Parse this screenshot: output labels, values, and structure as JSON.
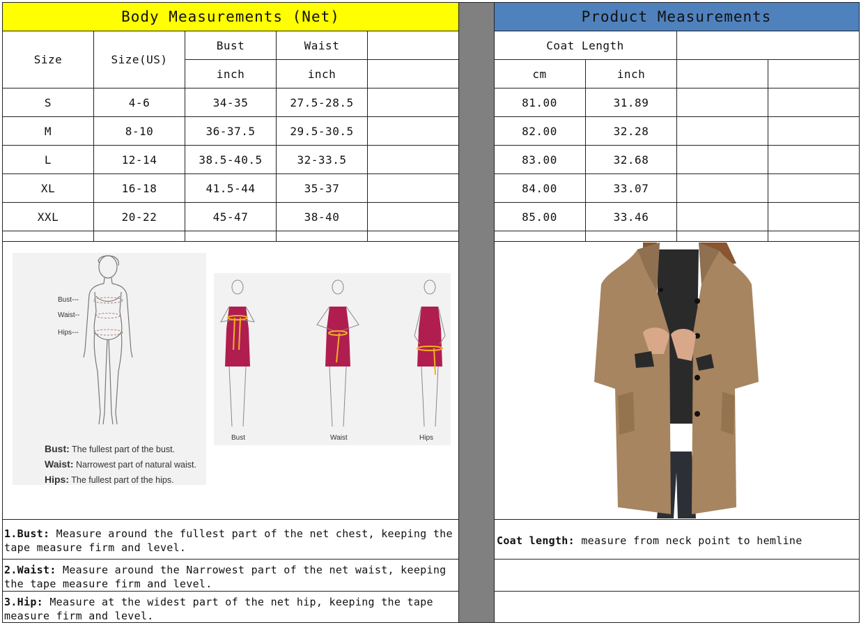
{
  "left_title": "Body Measurements (Net)",
  "right_title": "Product Measurements",
  "colors": {
    "left_header_bg": "#ffff00",
    "right_header_bg": "#4f81bd",
    "divider": "#808080"
  },
  "body_headers": {
    "size": "Size",
    "size_us": "Size(US)",
    "bust": "Bust",
    "waist": "Waist",
    "bust_unit": "inch",
    "waist_unit": "inch"
  },
  "product_headers": {
    "coat_length": "Coat Length",
    "cm": "cm",
    "inch": "inch"
  },
  "rows": [
    {
      "size": "S",
      "us": "4-6",
      "bust": "34-35",
      "waist": "27.5-28.5",
      "cm": "81.00",
      "inch": "31.89"
    },
    {
      "size": "M",
      "us": "8-10",
      "bust": "36-37.5",
      "waist": "29.5-30.5",
      "cm": "82.00",
      "inch": "32.28"
    },
    {
      "size": "L",
      "us": "12-14",
      "bust": "38.5-40.5",
      "waist": "32-33.5",
      "cm": "83.00",
      "inch": "32.68"
    },
    {
      "size": "XL",
      "us": "16-18",
      "bust": "41.5-44",
      "waist": "35-37",
      "cm": "84.00",
      "inch": "33.07"
    },
    {
      "size": "XXL",
      "us": "20-22",
      "bust": "45-47",
      "waist": "38-40",
      "cm": "85.00",
      "inch": "33.46"
    }
  ],
  "figure": {
    "label_bust": "Bust---",
    "label_waist": "Waist--",
    "label_hips": "Hips---",
    "cap_bust_term": "Bust:",
    "cap_bust_text": "The fullest part of the bust.",
    "cap_waist_term": "Waist:",
    "cap_waist_text": "Narrowest part of natural waist.",
    "cap_hips_term": "Hips:",
    "cap_hips_text": "The fullest part of the hips.",
    "dress_labels": [
      "Bust",
      "Waist",
      "Hips"
    ]
  },
  "notes": {
    "bust_term": "1.Bust:",
    "bust_text": " Measure around the fullest part of the net chest, keeping the tape  measure firm and level.",
    "waist_term": "2.Waist:",
    "waist_text": " Measure around the Narrowest part of the net waist, keeping the tape  measure firm and level.",
    "hip_term": "3.Hip:",
    "hip_text": " Measure at the widest part of the net hip, keeping the tape measure firm and level.",
    "coat_term": "Coat length:",
    "coat_text": " measure from neck point to hemline"
  }
}
